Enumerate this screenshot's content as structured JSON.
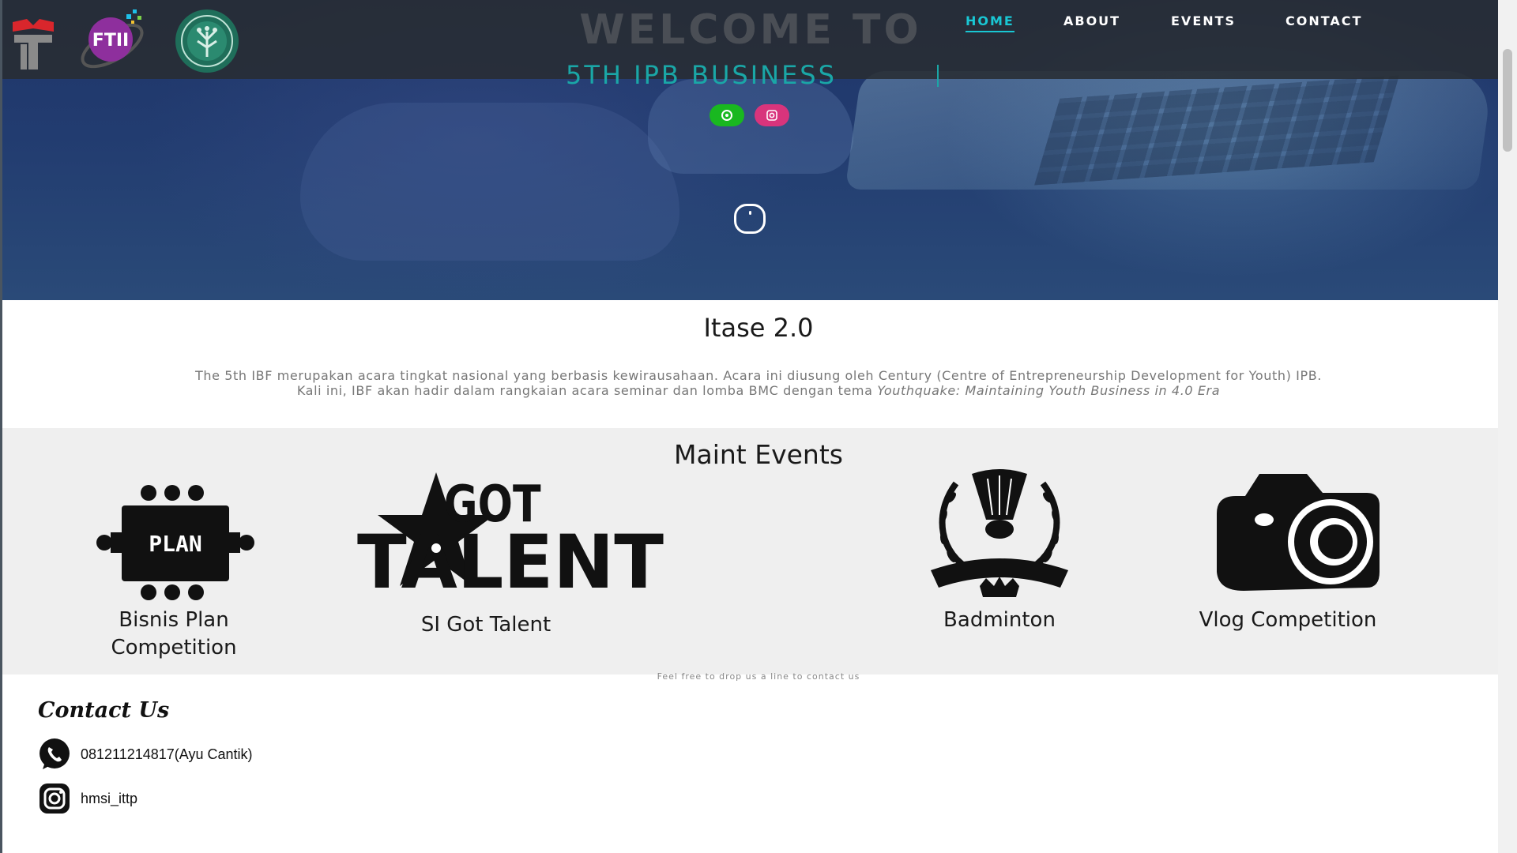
{
  "hero": {
    "welcome_text": "WELCOME TO",
    "typed_text": "5TH IPB BUSINESS"
  },
  "nav": {
    "items": [
      {
        "label": "HOME",
        "active": true
      },
      {
        "label": "ABOUT",
        "active": false
      },
      {
        "label": "EVENTS",
        "active": false
      },
      {
        "label": "CONTACT",
        "active": false
      }
    ]
  },
  "logos": {
    "ftii": "FTII"
  },
  "about": {
    "title": "Itase 2.0",
    "line1": "The 5th IBF merupakan acara tingkat nasional yang berbasis kewirausahaan. Acara ini diusung oleh Century (Centre of Entrepreneurship Development for Youth) IPB.",
    "line2_plain": "Kali ini, IBF akan hadir dalam rangkaian acara seminar dan lomba BMC dengan tema ",
    "line2_italic": "Youthquake: Maintaining Youth Business in 4.0 Era"
  },
  "events": {
    "title": "Maint Events",
    "items": [
      {
        "label": "Bisnis Plan Competition",
        "icon": "business-plan-icon",
        "icon_text": "PLAN"
      },
      {
        "label": "SI Got Talent",
        "icon": "got-talent-icon",
        "icon_text_top": "GOT",
        "icon_text_main": "TALENT"
      },
      {
        "label": "Badminton",
        "icon": "badminton-shuttlecock-icon"
      },
      {
        "label": "Vlog Competition",
        "icon": "camera-icon"
      }
    ]
  },
  "contact": {
    "tagline": "Feel free to drop us a line to contact us",
    "title": "Contact Us",
    "whatsapp": "081211214817(Ayu Cantik)",
    "instagram": "hmsi_ittp"
  },
  "colors": {
    "accent": "#19c7d4",
    "typed": "#1aa7a7",
    "whatsapp_button": "#19b820",
    "instagram_button": "#d8347c",
    "events_bg": "#efefef"
  }
}
